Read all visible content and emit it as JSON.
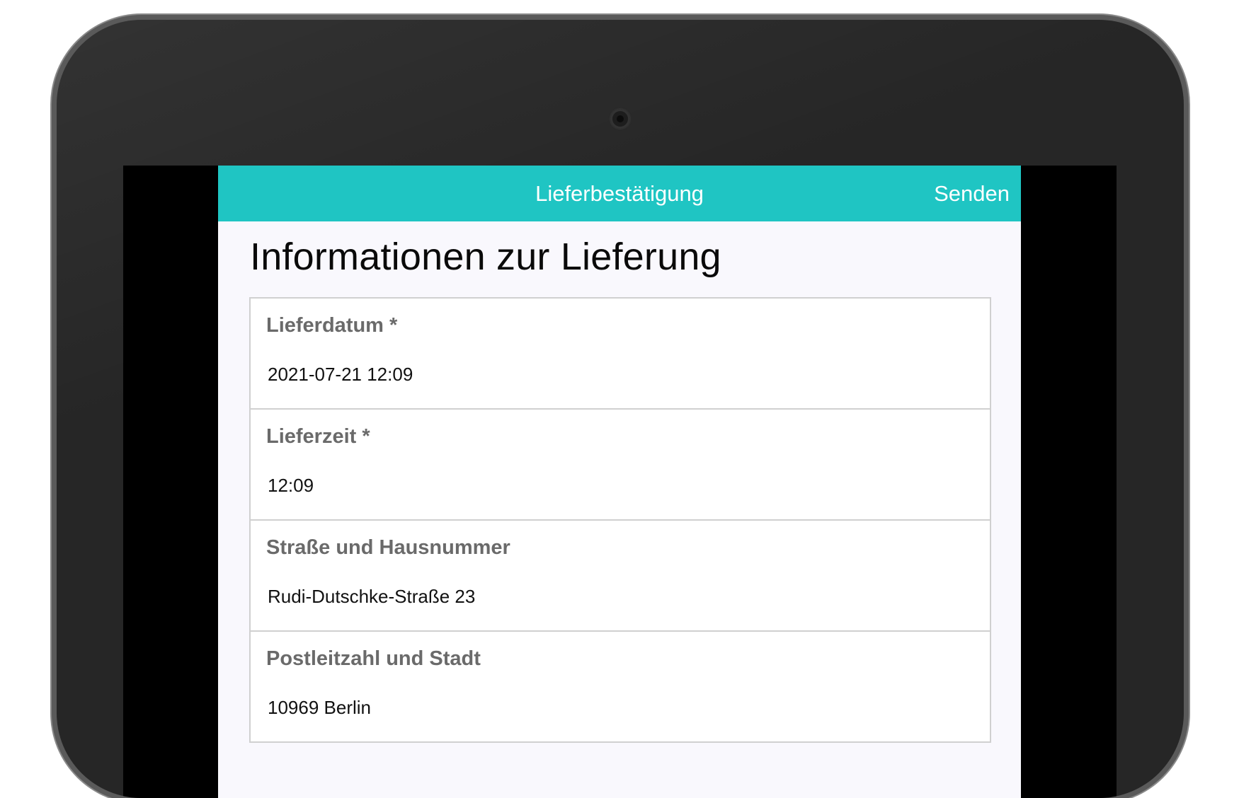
{
  "navbar": {
    "title": "Lieferbestätigung",
    "send_label": "Senden",
    "background_color": "#1fc5c3"
  },
  "page": {
    "heading": "Informationen zur Lieferung"
  },
  "fields": [
    {
      "label": "Lieferdatum *",
      "value": "2021-07-21 12:09"
    },
    {
      "label": "Lieferzeit *",
      "value": "12:09"
    },
    {
      "label": "Straße und Hausnummer",
      "value": "Rudi-Dutschke-Straße 23"
    },
    {
      "label": "Postleitzahl und Stadt",
      "value": "10969 Berlin"
    }
  ],
  "device": {
    "camera_icon": "camera-icon"
  }
}
